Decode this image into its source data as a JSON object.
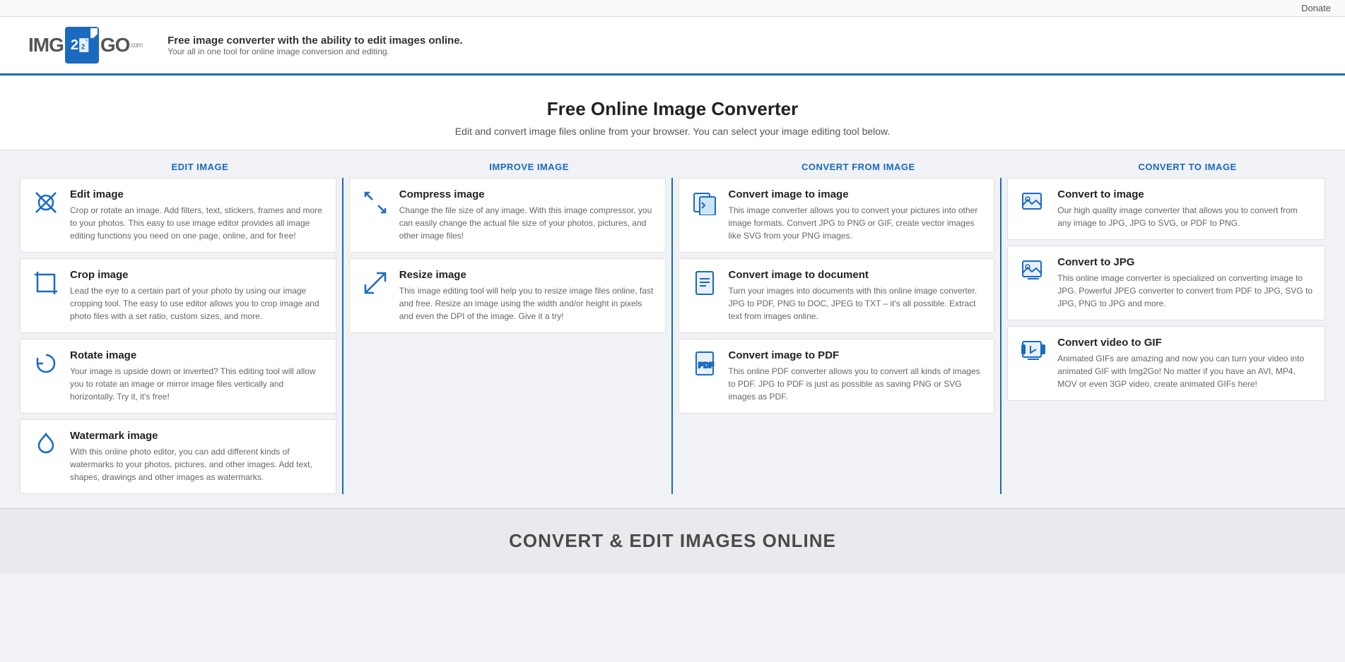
{
  "topbar": {
    "donate_label": "Donate"
  },
  "header": {
    "logo_text_pre": "IMG",
    "logo_num": "2",
    "logo_text_post": "GO",
    "logo_com": ".com",
    "tagline_main": "Free image converter with the ability to edit images online.",
    "tagline_sub": "Your all in one tool for online image conversion and editing."
  },
  "hero": {
    "title": "Free Online Image Converter",
    "subtitle": "Edit and convert image files online from your browser. You can select your image editing tool below."
  },
  "columns": [
    {
      "header": "EDIT IMAGE",
      "cards": [
        {
          "icon": "edit",
          "title": "Edit image",
          "body": "Crop or rotate an image. Add filters, text, stickers, frames and more to your photos. This easy to use image editor provides all image editing functions you need on one page, online, and for free!"
        },
        {
          "icon": "crop",
          "title": "Crop image",
          "body": "Lead the eye to a certain part of your photo by using our image cropping tool. The easy to use editor allows you to crop image and photo files with a set ratio, custom sizes, and more."
        },
        {
          "icon": "rotate",
          "title": "Rotate image",
          "body": "Your image is upside down or inverted? This editing tool will allow you to rotate an image or mirror image files vertically and horizontally. Try it, it's free!"
        },
        {
          "icon": "watermark",
          "title": "Watermark image",
          "body": "With this online photo editor, you can add different kinds of watermarks to your photos, pictures, and other images. Add text, shapes, drawings and other images as watermarks."
        }
      ]
    },
    {
      "header": "IMPROVE IMAGE",
      "cards": [
        {
          "icon": "compress",
          "title": "Compress image",
          "body": "Change the file size of any image. With this image compressor, you can easily change the actual file size of your photos, pictures, and other image files!"
        },
        {
          "icon": "resize",
          "title": "Resize image",
          "body": "This image editing tool will help you to resize image files online, fast and free. Resize an image using the width and/or height in pixels and even the DPI of the image. Give it a try!"
        }
      ]
    },
    {
      "header": "CONVERT FROM IMAGE",
      "cards": [
        {
          "icon": "img2img",
          "title": "Convert image to image",
          "body": "This image converter allows you to convert your pictures into other image formats. Convert JPG to PNG or GIF, create vector images like SVG from your PNG images."
        },
        {
          "icon": "img2doc",
          "title": "Convert image to document",
          "body": "Turn your images into documents with this online image converter. JPG to PDF, PNG to DOC, JPEG to TXT – it's all possible. Extract text from images online."
        },
        {
          "icon": "img2pdf",
          "title": "Convert image to PDF",
          "body": "This online PDF converter allows you to convert all kinds of images to PDF. JPG to PDF is just as possible as saving PNG or SVG images as PDF."
        }
      ]
    },
    {
      "header": "CONVERT TO IMAGE",
      "cards": [
        {
          "icon": "to-img",
          "title": "Convert to image",
          "body": "Our high quality image converter that allows you to convert from any image to JPG, JPG to SVG, or PDF to PNG."
        },
        {
          "icon": "to-jpg",
          "title": "Convert to JPG",
          "body": "This online image converter is specialized on converting image to JPG. Powerful JPEG converter to convert from PDF to JPG, SVG to JPG, PNG to JPG and more."
        },
        {
          "icon": "to-gif",
          "title": "Convert video to GIF",
          "body": "Animated GIFs are amazing and now you can turn your video into animated GIF with Img2Go! No matter if you have an AVI, MP4, MOV or even 3GP video, create animated GIFs here!"
        }
      ]
    }
  ],
  "footer": {
    "title": "CONVERT & EDIT IMAGES ONLINE"
  }
}
